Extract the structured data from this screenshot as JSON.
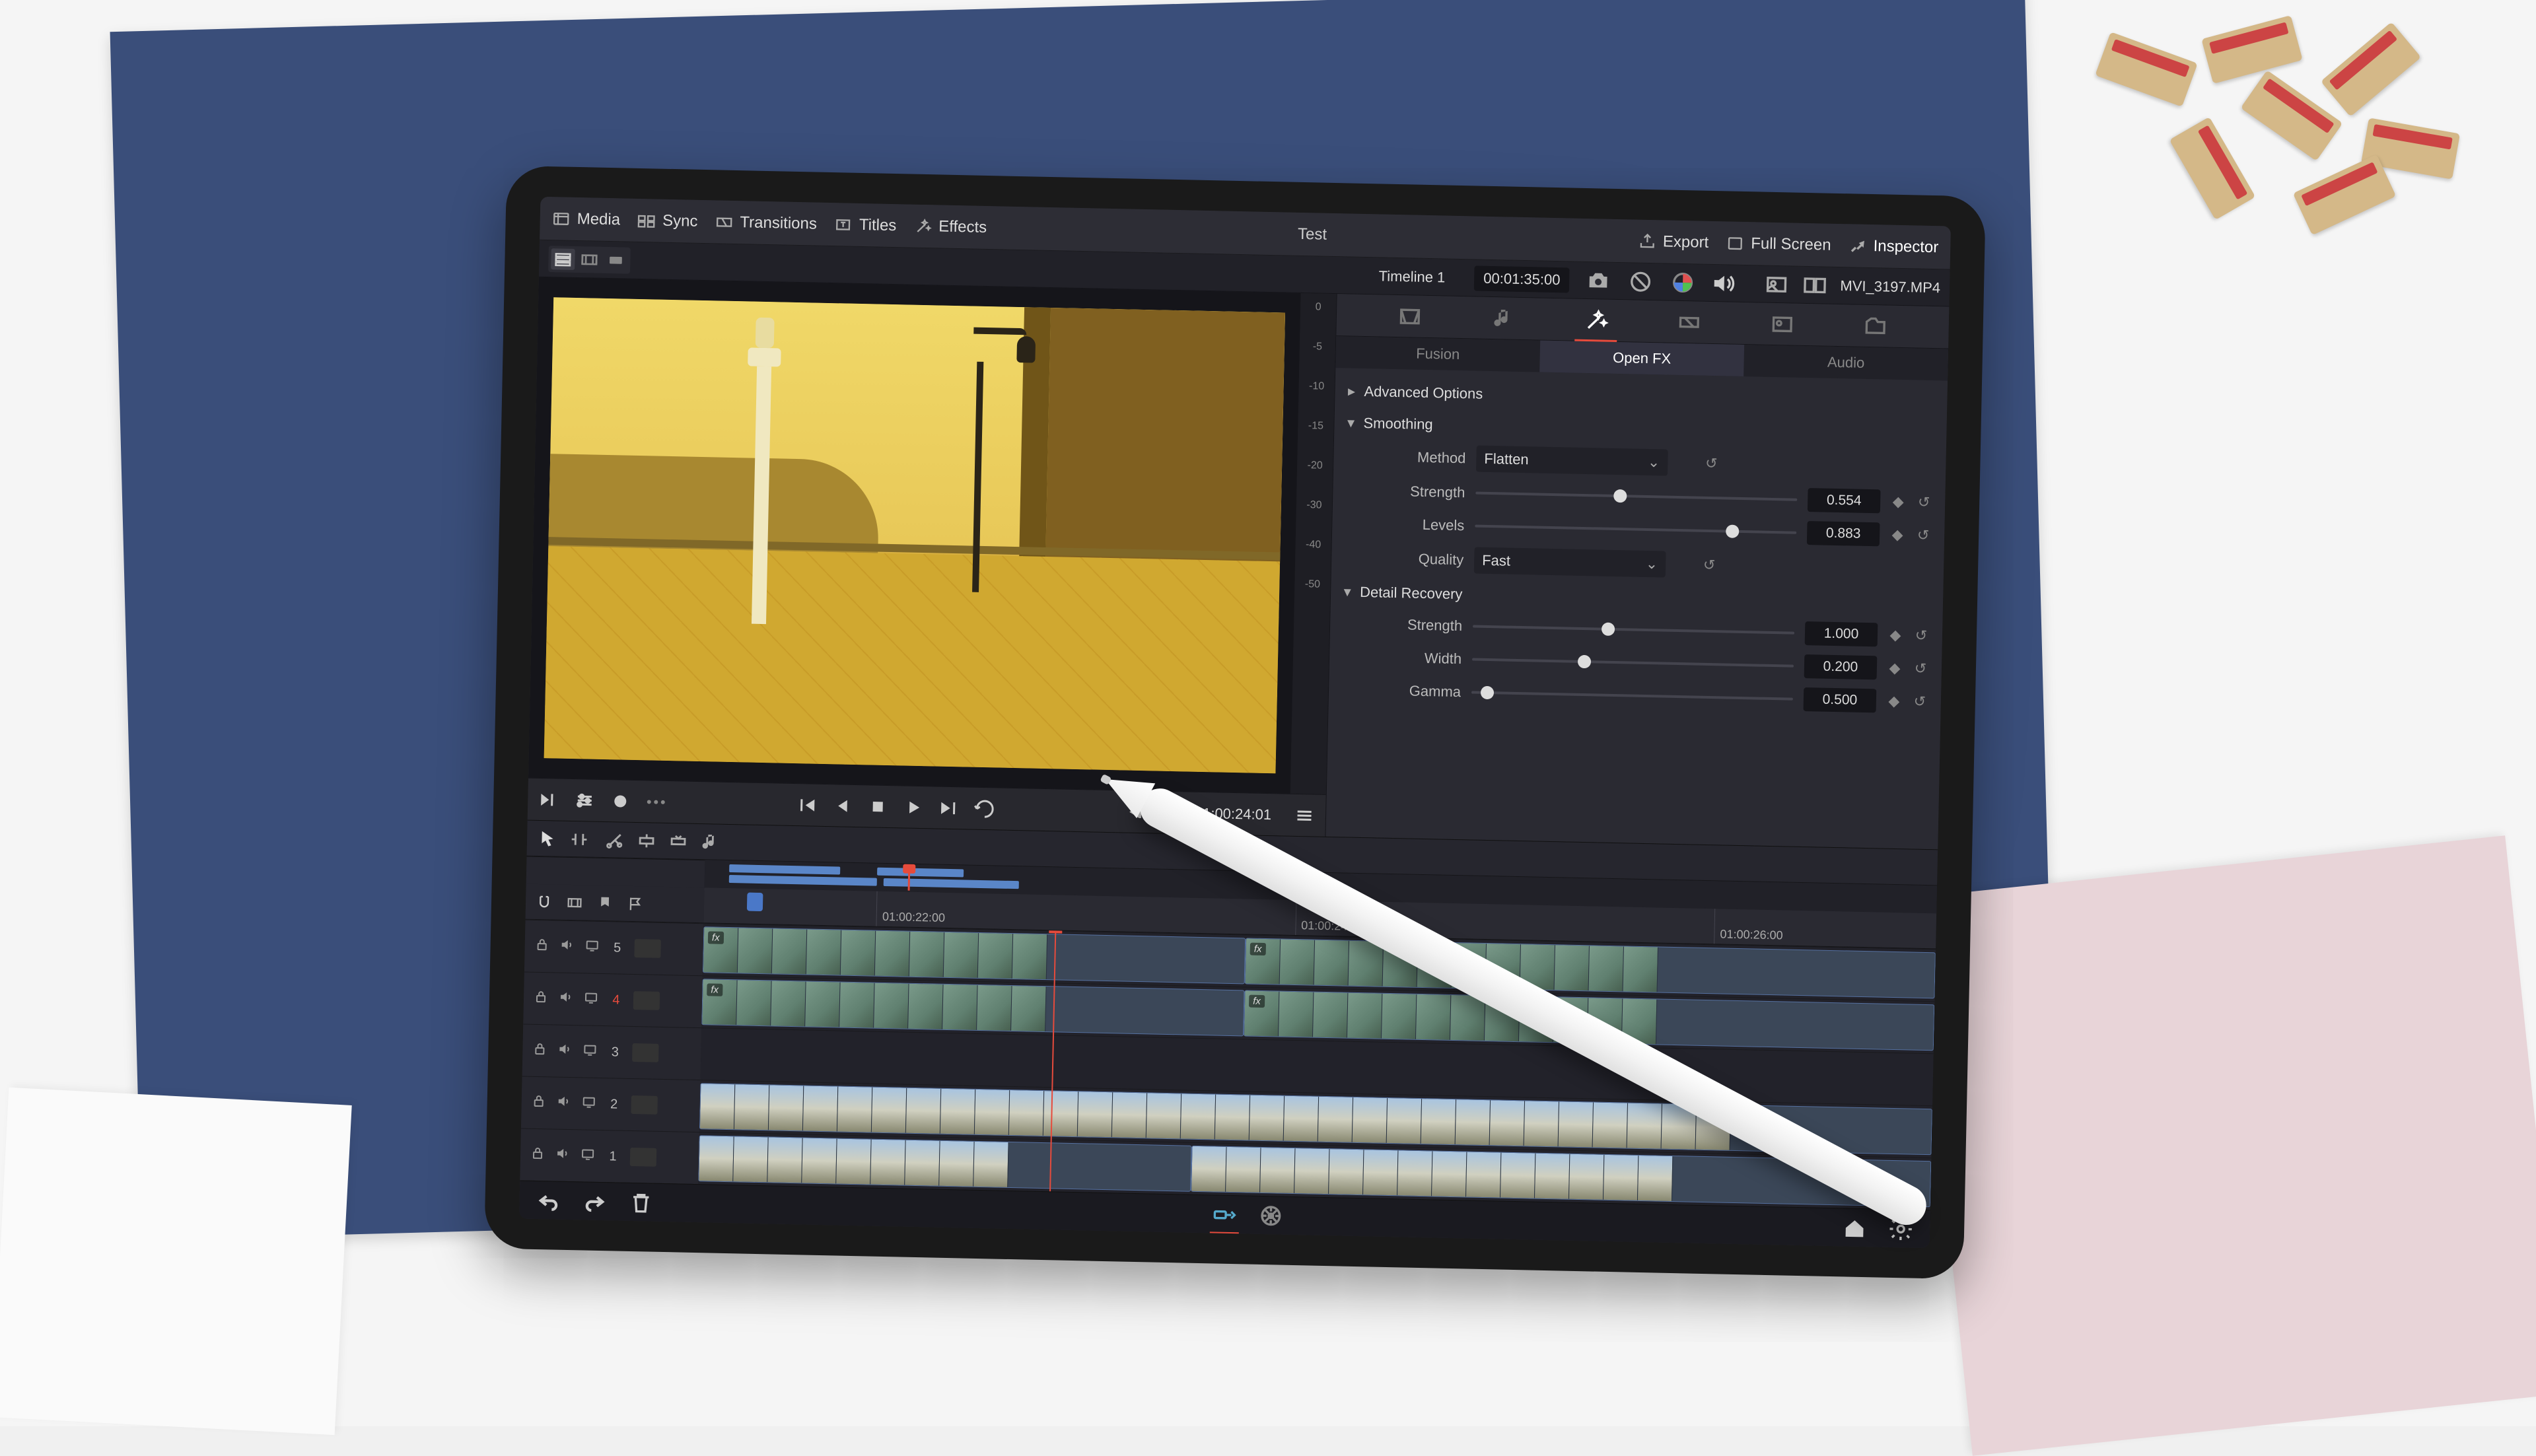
{
  "topbar": {
    "media": "Media",
    "sync": "Sync",
    "transitions": "Transitions",
    "titles": "Titles",
    "effects": "Effects",
    "project": "Test",
    "export": "Export",
    "fullscreen": "Full Screen",
    "inspector": "Inspector"
  },
  "bar2": {
    "timeline_name": "Timeline 1",
    "timeline_tc": "00:01:35:00",
    "clip_name": "MVI_3197.MP4"
  },
  "vu_marks": [
    "0",
    "-5",
    "-10",
    "-15",
    "-20",
    "-30",
    "-40",
    "-50"
  ],
  "transport": {
    "tc": "01:00:24:01"
  },
  "inspector": {
    "sub_tabs": [
      "Fusion",
      "Open FX",
      "Audio"
    ],
    "active_sub": 1,
    "adv": "Advanced Options",
    "smoothing": {
      "title": "Smoothing",
      "method_label": "Method",
      "method_value": "Flatten",
      "strength_label": "Strength",
      "strength_value": "0.554",
      "strength_pos": 0.45,
      "levels_label": "Levels",
      "levels_value": "0.883",
      "levels_pos": 0.8,
      "quality_label": "Quality",
      "quality_value": "Fast"
    },
    "detail": {
      "title": "Detail Recovery",
      "strength_label": "Strength",
      "strength_value": "1.000",
      "strength_pos": 0.42,
      "width_label": "Width",
      "width_value": "0.200",
      "width_pos": 0.35,
      "gamma_label": "Gamma",
      "gamma_value": "0.500",
      "gamma_pos": 0.05
    }
  },
  "ruler": {
    "marks": [
      {
        "label": "01:00:22:00",
        "pos": 0.14
      },
      {
        "label": "01:00:24:00",
        "pos": 0.48
      },
      {
        "label": "01:00:26:00",
        "pos": 0.82
      }
    ],
    "marker_pos": 0.035
  },
  "playhead_pos": 0.285,
  "tracks": [
    {
      "num": "5",
      "sel": false
    },
    {
      "num": "4",
      "sel": true
    },
    {
      "num": "3",
      "sel": false
    },
    {
      "num": "2",
      "sel": false
    },
    {
      "num": "1",
      "sel": false
    }
  ],
  "lanes": [
    {
      "clips": [
        {
          "l": 0,
          "w": 0.44,
          "fx": true,
          "th": 10,
          "sky": false
        },
        {
          "l": 0.44,
          "w": 0.56,
          "fx": true,
          "th": 12,
          "sky": false
        }
      ]
    },
    {
      "clips": [
        {
          "l": 0,
          "w": 0.44,
          "fx": true,
          "th": 10,
          "sky": false
        },
        {
          "l": 0.44,
          "w": 0.56,
          "fx": true,
          "th": 12,
          "sky": false
        }
      ]
    },
    {
      "clips": []
    },
    {
      "clips": [
        {
          "l": 0,
          "w": 1.0,
          "fx": false,
          "th": 30,
          "sky": true
        }
      ]
    },
    {
      "clips": [
        {
          "l": 0,
          "w": 0.4,
          "fx": false,
          "th": 9,
          "sky": true
        },
        {
          "l": 0.4,
          "w": 0.6,
          "fx": false,
          "th": 14,
          "sky": true
        }
      ]
    }
  ],
  "mini": {
    "clips": [
      {
        "l": 0.02,
        "w": 0.09,
        "row": "a"
      },
      {
        "l": 0.02,
        "w": 0.12,
        "row": "b"
      },
      {
        "l": 0.14,
        "w": 0.07,
        "row": "a"
      },
      {
        "l": 0.145,
        "w": 0.11,
        "row": "b"
      }
    ],
    "ph": 0.165
  }
}
